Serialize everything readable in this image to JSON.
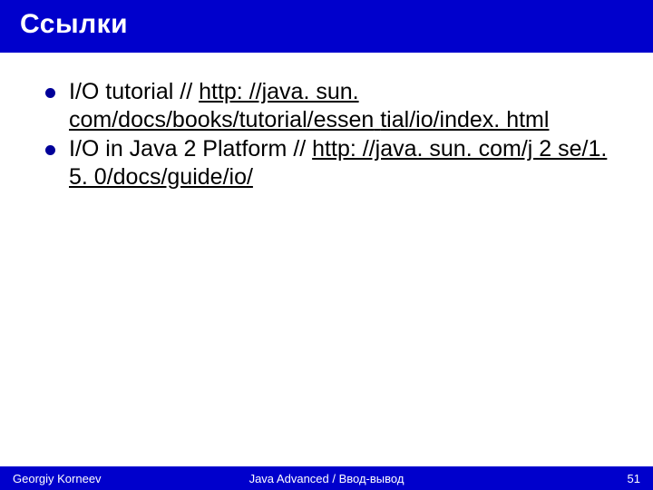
{
  "header": {
    "title": "Ссылки"
  },
  "bullets": [
    {
      "prefix": "I/O tutorial // ",
      "link_line1": "http: //java. sun. com/docs/books/tutorial/essen",
      "link_line2": "tial/io/index. html"
    },
    {
      "prefix": "I/O in Java 2 Platform // ",
      "link_line1": "http: //java. sun. com/j 2 se/1. 5. 0/docs/guide/io/",
      "link_line2": ""
    }
  ],
  "footer": {
    "author": "Georgiy Korneev",
    "course": "Java Advanced / Ввод-вывод",
    "page": "51"
  }
}
